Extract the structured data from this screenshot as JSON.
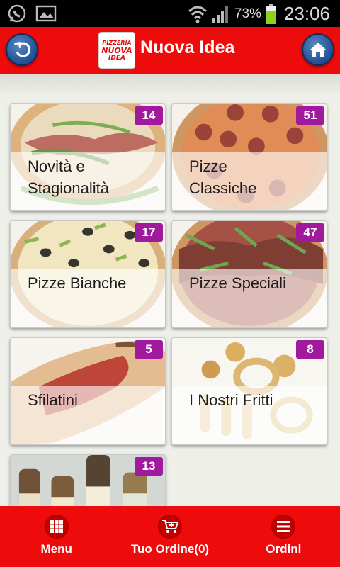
{
  "status_bar": {
    "battery_percent": "73%",
    "time": "23:06",
    "icons": [
      "whatsapp-icon",
      "gallery-icon",
      "wifi-icon",
      "signal-icon",
      "battery-icon"
    ]
  },
  "header": {
    "title": "Nuova Idea",
    "logo_text": [
      "PIZZERIA",
      "NUOVA",
      "IDEA"
    ],
    "back_icon": "back-arrow-icon",
    "home_icon": "home-icon"
  },
  "categories": [
    {
      "label_lines": [
        "Novità e",
        "Stagionalità"
      ],
      "count": "14"
    },
    {
      "label_lines": [
        "Pizze",
        "Classiche"
      ],
      "count": "51"
    },
    {
      "label_lines": [
        "Pizze Bianche"
      ],
      "count": "17"
    },
    {
      "label_lines": [
        "Pizze Speciali"
      ],
      "count": "47"
    },
    {
      "label_lines": [
        "Sfilatini"
      ],
      "count": "5"
    },
    {
      "label_lines": [
        "I Nostri Fritti"
      ],
      "count": "8"
    },
    {
      "label_lines": [],
      "count": "13"
    }
  ],
  "bottom_bar": {
    "menu": "Menu",
    "order": "Tuo Ordine(0)",
    "orders": "Ordini"
  },
  "colors": {
    "header_red": "#ee0b0b",
    "badge_purple": "#a1199d",
    "button_blue": "#2a5ea8"
  }
}
